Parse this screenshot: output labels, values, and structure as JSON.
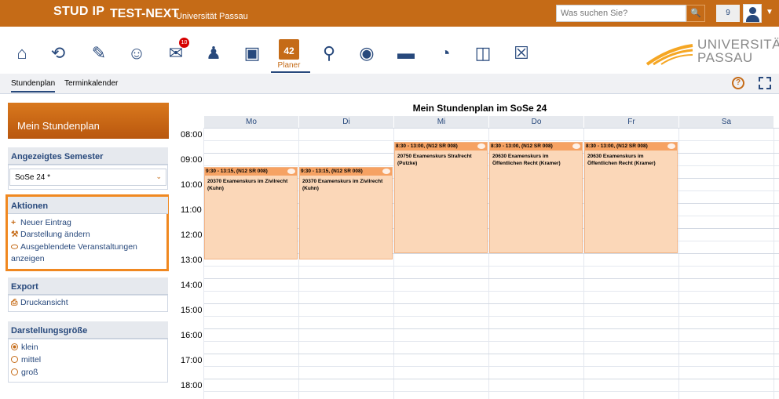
{
  "header": {
    "brand": "STUD IP",
    "instance": "TEST-NEXT",
    "university": "Universität Passau",
    "search_placeholder": "Was suchen Sie?",
    "notification_count": "9"
  },
  "nav": {
    "messages_badge": "10",
    "planer_day": "42",
    "planer_label": "Planer",
    "logo_line1": "UNIVERSITÄT",
    "logo_line2": "PASSAU"
  },
  "subtabs": [
    {
      "label": "Stundenplan",
      "active": true
    },
    {
      "label": "Terminkalender",
      "active": false
    }
  ],
  "sidebar": {
    "title": "Mein Stundenplan",
    "semester_heading": "Angezeigtes Semester",
    "semester_value": "SoSe 24 *",
    "actions_heading": "Aktionen",
    "actions": [
      {
        "label": "Neuer Eintrag",
        "icon": "plus-icon"
      },
      {
        "label": "Darstellung ändern",
        "icon": "wrench-icon"
      },
      {
        "label": "Ausgeblendete Veranstaltungen anzeigen",
        "icon": "visibility-icon"
      }
    ],
    "export_heading": "Export",
    "print_label": "Druckansicht",
    "size_heading": "Darstellungsgröße",
    "sizes": [
      {
        "label": "klein",
        "selected": true
      },
      {
        "label": "mittel",
        "selected": false
      },
      {
        "label": "groß",
        "selected": false
      }
    ]
  },
  "calendar": {
    "title": "Mein Stundenplan im SoSe 24",
    "days": [
      "Mo",
      "Di",
      "Mi",
      "Do",
      "Fr",
      "Sa"
    ],
    "hours": [
      "08:00",
      "09:00",
      "10:00",
      "11:00",
      "12:00",
      "13:00",
      "14:00",
      "15:00",
      "16:00",
      "17:00",
      "18:00"
    ],
    "events": [
      {
        "day": 0,
        "start": 9.5,
        "end": 13.25,
        "time": "9:30 - 13:15, (N12 SR 008)",
        "title": "20370 Examenskurs im Zivilrecht (Kuhn)"
      },
      {
        "day": 1,
        "start": 9.5,
        "end": 13.25,
        "time": "9:30 - 13:15, (N12 SR 008)",
        "title": "20370 Examenskurs im Zivilrecht (Kuhn)"
      },
      {
        "day": 2,
        "start": 8.5,
        "end": 13.0,
        "time": "8:30 - 13:00, (N12 SR 008)",
        "title": "20750 Examenskurs Strafrecht (Putzke)"
      },
      {
        "day": 3,
        "start": 8.5,
        "end": 13.0,
        "time": "8:30 - 13:00, (N12 SR 008)",
        "title": "20630 Examenskurs im Öffentlichen Recht (Kramer)"
      },
      {
        "day": 4,
        "start": 8.5,
        "end": 13.0,
        "time": "8:30 - 13:00, (N12 SR 008)",
        "title": "20630 Examenskurs im Öffentlichen Recht (Kramer)"
      }
    ]
  },
  "colors": {
    "accent": "#c56b17",
    "link": "#28497c",
    "event_bg": "#fbd7b8",
    "event_head": "#f6a263"
  }
}
